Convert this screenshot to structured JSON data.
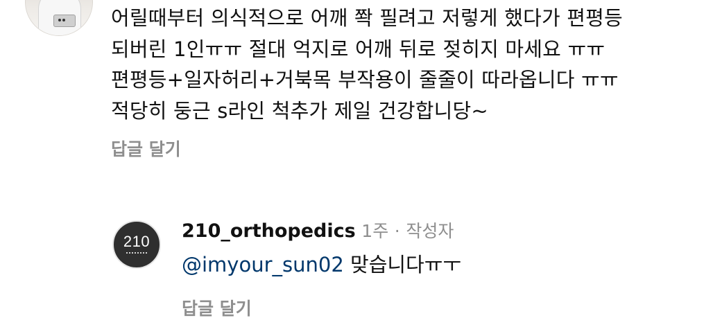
{
  "top_comment": {
    "lines": [
      "어릴때부터 의식적으로 어깨 쫙 필려고 저렇게 했다가 편평등",
      "되버린 1인ㅠㅠ 절대  억지로 어깨 뒤로 젖히지 마세요 ㅠㅠ",
      "편평등+일자허리+거북목 부작용이 줄줄이 따라옵니다 ㅠㅠ",
      "적당히 둥근 s라인 척추가 제일 건강합니당~"
    ],
    "reply_label": "답글 달기"
  },
  "reply_comment": {
    "avatar_text": "210",
    "username": "210_orthopedics",
    "time": "1주",
    "separator": "·",
    "author_badge": "작성자",
    "mention": "@imyour_sun02",
    "text": " 맞습니다ㅠㅜ",
    "reply_label": "답글 달기"
  }
}
